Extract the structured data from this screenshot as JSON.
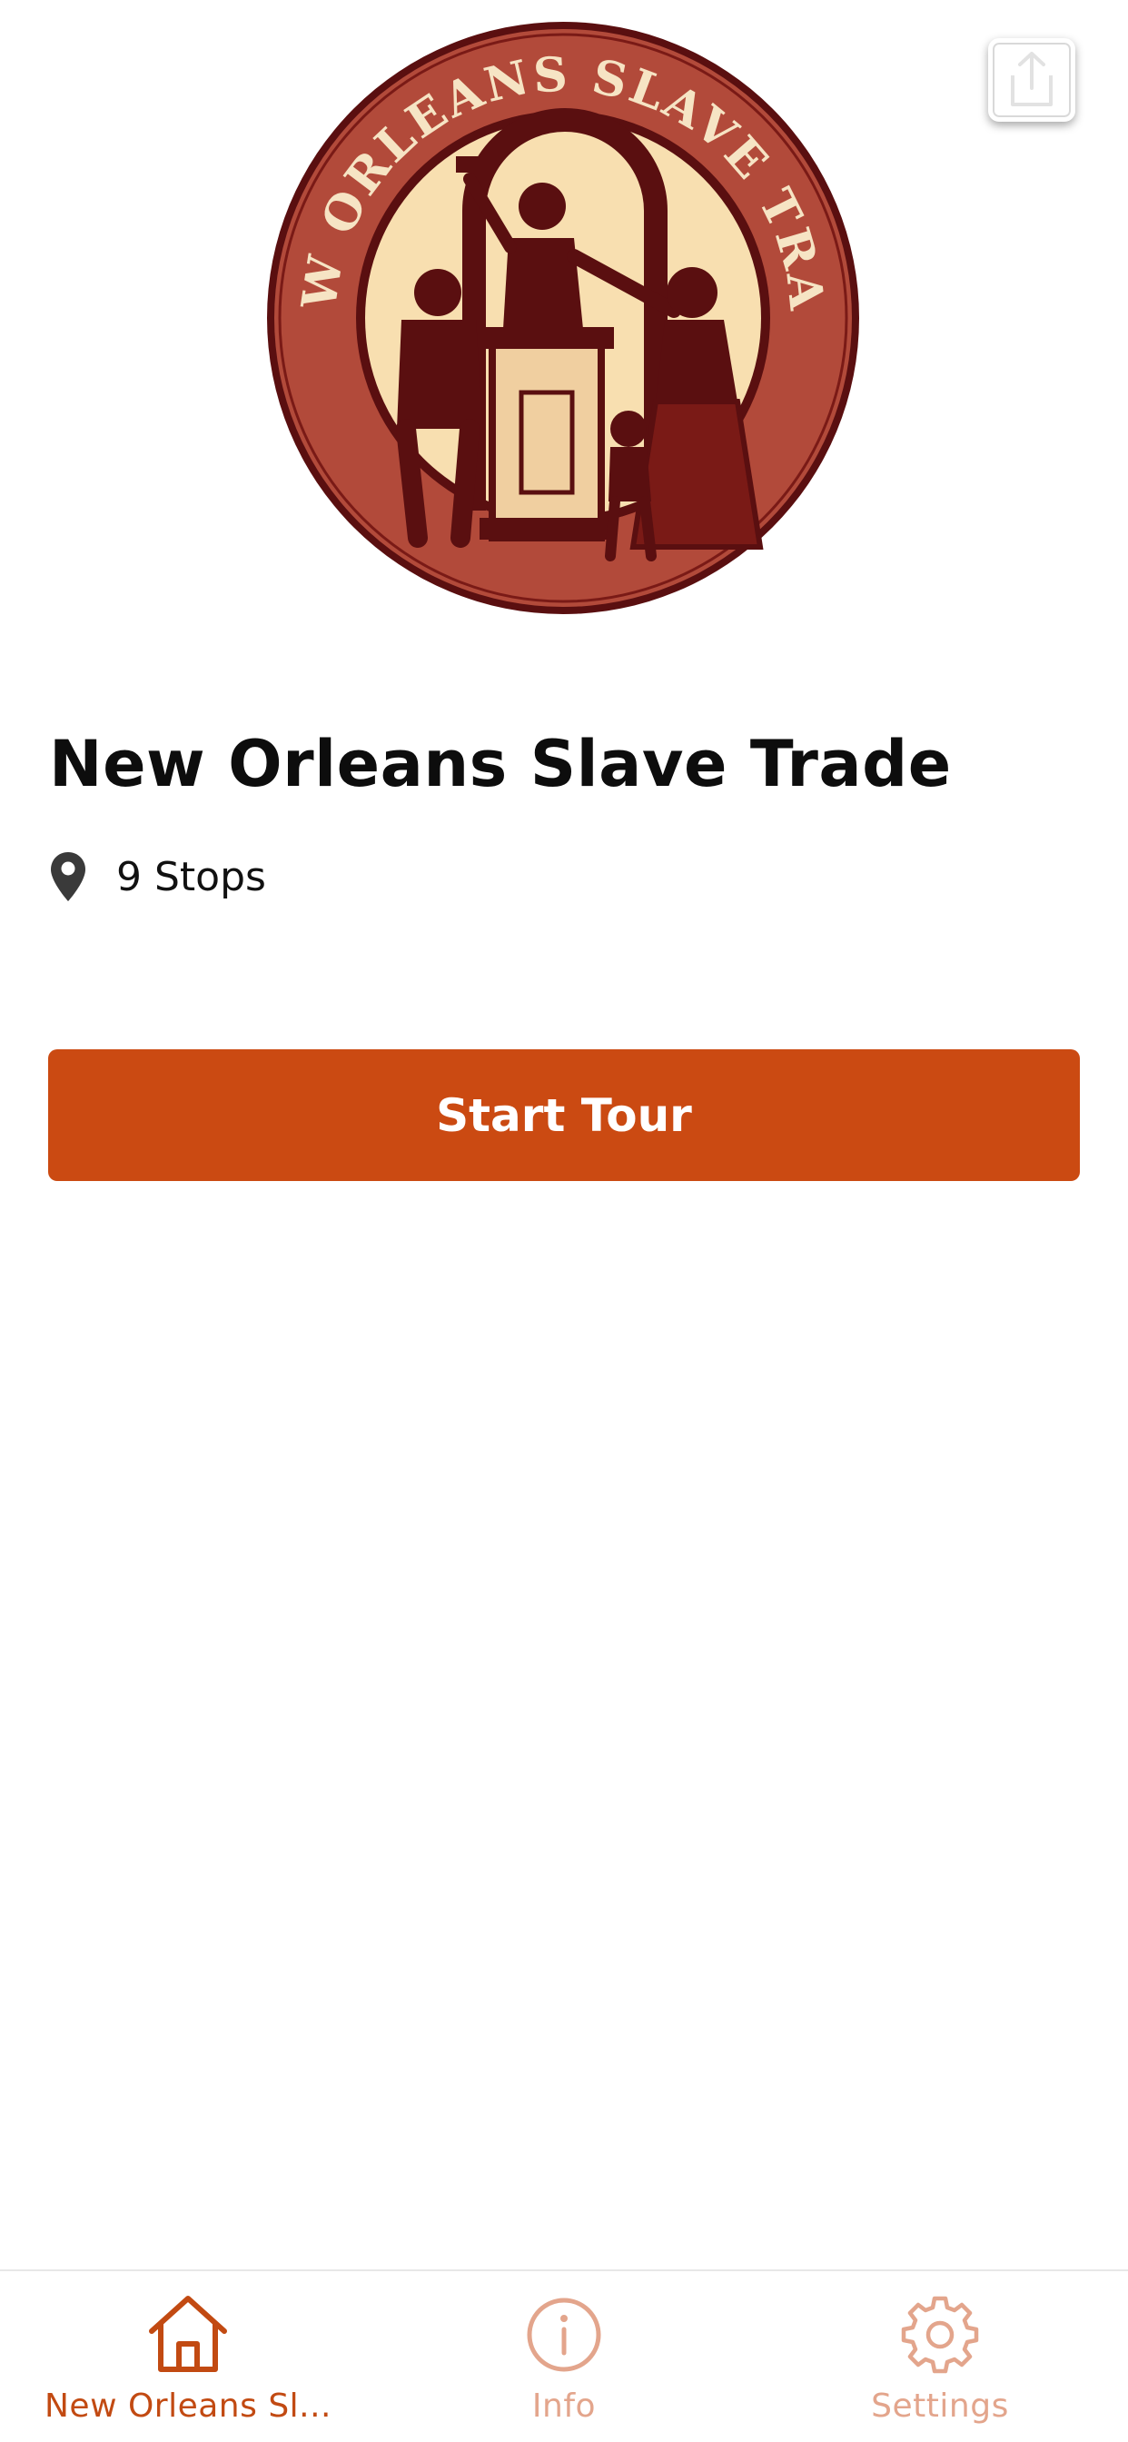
{
  "tour": {
    "title": "New Orleans Slave Trade",
    "stops_label": "9 Stops",
    "logo_text": "NEW ORLEANS SLAVE TRADE"
  },
  "actions": {
    "start_label": "Start Tour"
  },
  "icons": {
    "share": "share-icon",
    "pin": "map-pin-icon",
    "home": "home-icon",
    "info": "info-icon",
    "settings": "gear-icon"
  },
  "tabs": [
    {
      "label": "New Orleans Sl...",
      "active": true
    },
    {
      "label": "Info",
      "active": false
    },
    {
      "label": "Settings",
      "active": false
    }
  ],
  "colors": {
    "accent": "#cb4a12",
    "tab_active": "#c24a12",
    "tab_inactive": "#e3a58c",
    "logo_outer": "#b24a3a",
    "logo_inner": "#f8dfb0",
    "logo_dark": "#5a0f10"
  }
}
